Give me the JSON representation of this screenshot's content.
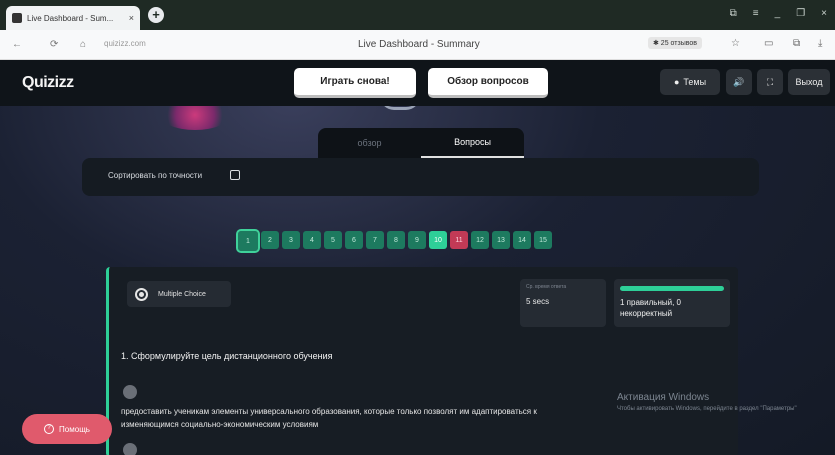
{
  "browser": {
    "tab_title": "Live Dashboard - Sum...",
    "tab_close": "×",
    "new_tab": "+",
    "window_controls": [
      "⧉",
      "≡",
      "_",
      "❐",
      "×"
    ],
    "nav": [
      "←",
      "⟳",
      "⌂"
    ],
    "url": "quizizz.com",
    "page_title": "Live Dashboard - Summary",
    "chip": "✱ 25 отзывов",
    "right_icons": [
      "☆",
      "▭",
      "⧉",
      "⤓"
    ]
  },
  "app": {
    "logo": "Quizizz",
    "play_again": "Играть снова!",
    "review_questions": "Обзор вопросов",
    "themes": "Темы",
    "sound_icon": "🔊",
    "fullscreen_icon": "⛶",
    "exit": "Выход",
    "tabs": [
      "обзор",
      "Вопросы"
    ],
    "sort_label": "Сортировать по точности",
    "question_numbers": [
      "1",
      "2",
      "3",
      "4",
      "5",
      "6",
      "7",
      "8",
      "9",
      "10",
      "11",
      "12",
      "13",
      "14",
      "15"
    ],
    "question_type": "Multiple Choice",
    "stat_time_label": "Ср. время ответа",
    "stat_time_value": "5 secs",
    "stat_correct_value": "1 правильный, 0 некорректный",
    "question_title": "1. Сформулируйте цель дистанционного обучения",
    "answer_text": "предоставить ученикам элементы универсального образования, которые только позволят им адаптироваться к изменяющимся социально-экономическим условиям",
    "help_label": "Помощь",
    "watermark_title": "Активация Windows",
    "watermark_text": "Чтобы активировать Windows, перейдите в раздел \"Параметры\""
  },
  "colors": {
    "accent": "#2ecf98",
    "incorrect": "#c23a56",
    "help": "#e05a6c"
  }
}
